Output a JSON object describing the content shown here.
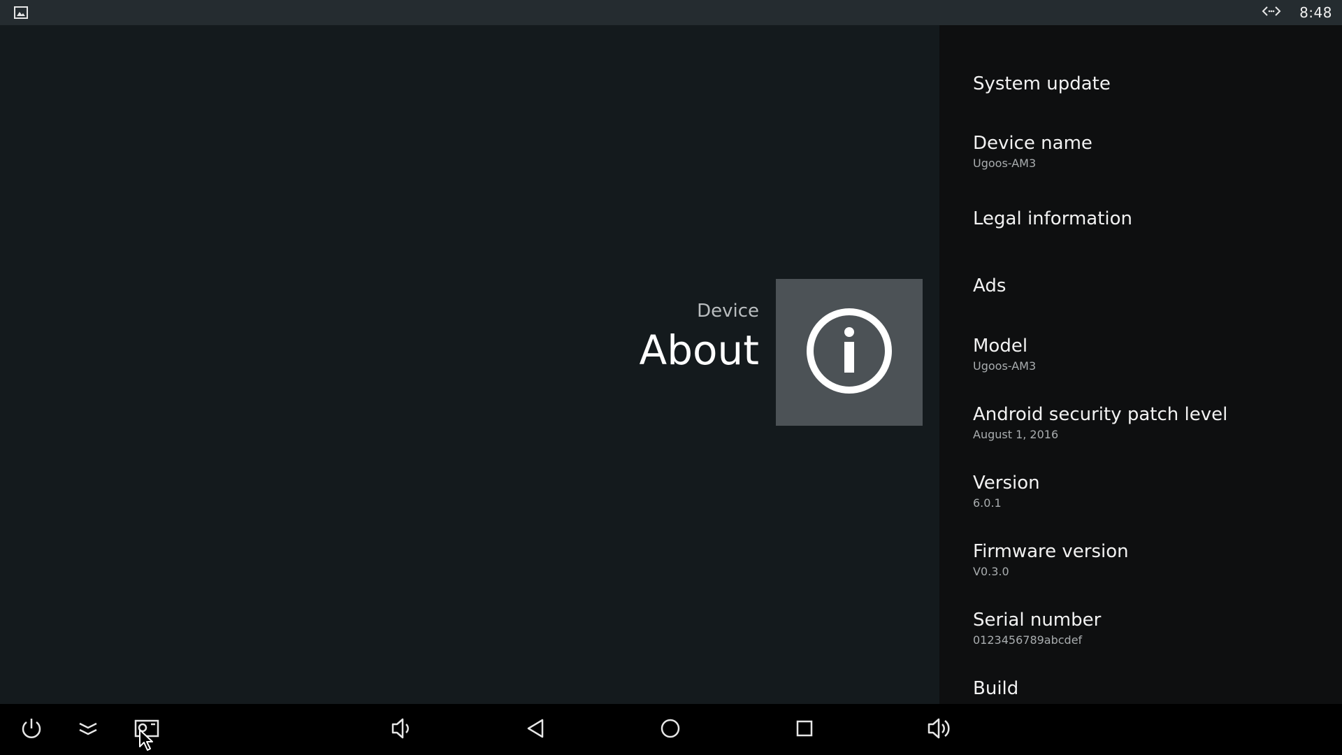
{
  "status_bar": {
    "time": "8:48",
    "left_icon": "image-icon",
    "right_icon": "code-arrows-icon"
  },
  "header": {
    "kicker": "Device",
    "title": "About",
    "icon": "info-icon"
  },
  "settings": {
    "items": [
      {
        "title": "System update",
        "summary": ""
      },
      {
        "title": "Device name",
        "summary": "Ugoos-AM3"
      },
      {
        "title": "Legal information",
        "summary": ""
      },
      {
        "title": "Ads",
        "summary": ""
      },
      {
        "title": "Model",
        "summary": "Ugoos-AM3"
      },
      {
        "title": "Android security patch level",
        "summary": "August 1, 2016"
      },
      {
        "title": "Version",
        "summary": "6.0.1"
      },
      {
        "title": "Firmware version",
        "summary": "V0.3.0"
      },
      {
        "title": "Serial number",
        "summary": "0123456789abcdef"
      },
      {
        "title": "Build",
        "summary": ""
      }
    ]
  },
  "nav_bar": {
    "buttons": [
      {
        "name": "power-icon"
      },
      {
        "name": "collapse-icon"
      },
      {
        "name": "screenshot-icon"
      },
      {
        "name": "volume-down-icon"
      },
      {
        "name": "back-icon"
      },
      {
        "name": "home-icon"
      },
      {
        "name": "recents-icon"
      },
      {
        "name": "volume-up-icon"
      }
    ]
  },
  "colors": {
    "status_bar": "#252c30",
    "main_bg": "#141a1d",
    "panel_bg": "#0e0f10",
    "tile_bg": "#4c5256",
    "nav_bg": "#000000"
  }
}
